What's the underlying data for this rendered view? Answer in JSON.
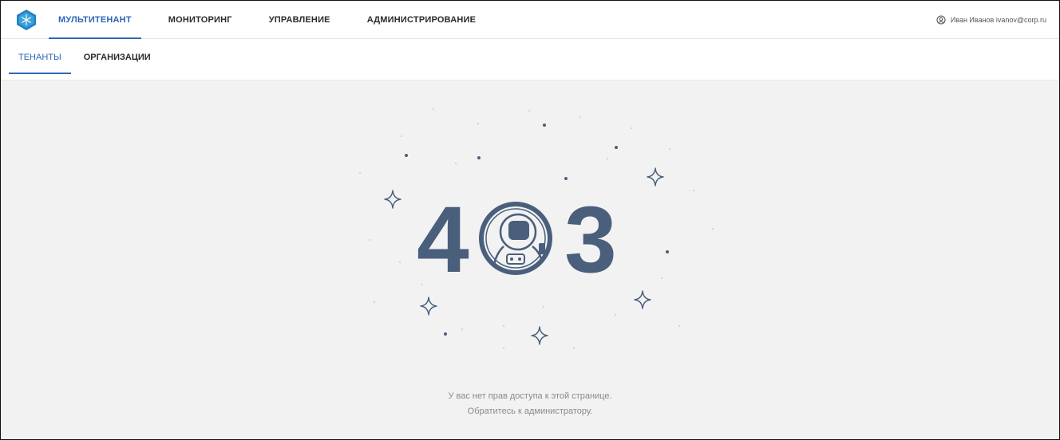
{
  "nav": {
    "items": [
      {
        "label": "МУЛЬТИТЕНАНТ",
        "active": true
      },
      {
        "label": "МОНИТОРИНГ",
        "active": false
      },
      {
        "label": "УПРАВЛЕНИЕ",
        "active": false
      },
      {
        "label": "АДМИНИСТРИРОВАНИЕ",
        "active": false
      }
    ]
  },
  "user": {
    "label": "Иван Иванов ivanov@corp.ru",
    "icon": "user-circle-icon"
  },
  "subnav": {
    "items": [
      {
        "label": "ТЕНАНТЫ",
        "active": true
      },
      {
        "label": "ОРГАНИЗАЦИИ",
        "active": false
      }
    ]
  },
  "error": {
    "code_left": "4",
    "code_right": "3",
    "line1": "У вас нет прав доступа к этой странице.",
    "line2": "Обратитесь к администратору."
  },
  "colors": {
    "accent": "#2f66b8",
    "illustration": "#495f7c",
    "logo": "#3aa0d8"
  }
}
